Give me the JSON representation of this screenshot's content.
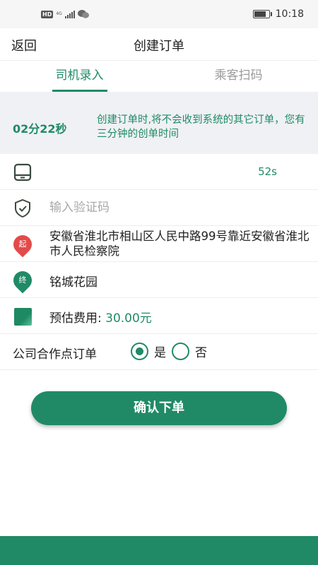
{
  "status_bar": {
    "left_badge": "HD",
    "network": "4G",
    "time": "10:18",
    "battery_level": 0.9,
    "icons": [
      "signal-icon",
      "wechat-icon",
      "battery-icon"
    ]
  },
  "navbar": {
    "back_label": "返回",
    "title": "创建订单"
  },
  "tabs": [
    {
      "label": "司机录入",
      "active": true
    },
    {
      "label": "乘客扫码",
      "active": false
    }
  ],
  "notice": {
    "timer": "02分22秒",
    "message": "创建订单时,将不会收到系统的其它订单，您有三分钟的创单时间"
  },
  "phone_row": {
    "icon": "tablet-icon",
    "countdown": "52s"
  },
  "code_row": {
    "icon": "shield-check-icon",
    "placeholder": "输入验证码",
    "value": ""
  },
  "start_row": {
    "icon_text": "起",
    "address": "安徽省淮北市相山区人民中路99号靠近安徽省淮北市人民检察院"
  },
  "end_row": {
    "icon_text": "终",
    "address": "铭城花园"
  },
  "fee_row": {
    "label": "预估费用: ",
    "value": "30.00元"
  },
  "coop_row": {
    "label": "公司合作点订单",
    "options": [
      {
        "label": "是",
        "selected": true
      },
      {
        "label": "否",
        "selected": false
      }
    ]
  },
  "confirm_button": "确认下单",
  "colors": {
    "primary": "#208A66",
    "start_pin": "#E34A4A",
    "end_pin": "#208A66",
    "notice_bg": "#EFF1F4"
  }
}
